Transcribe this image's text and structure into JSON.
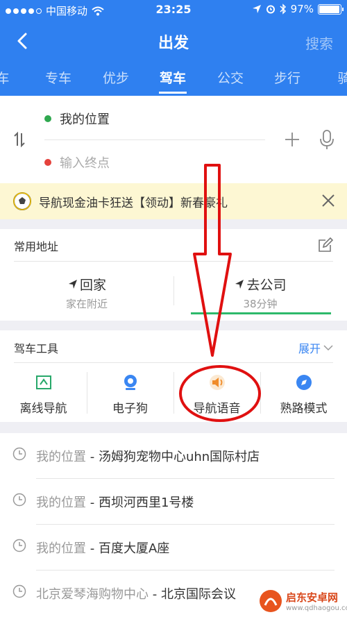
{
  "status_bar": {
    "carrier": "中国移动",
    "time": "23:25",
    "battery": "97%",
    "battery_level": 0.97
  },
  "header": {
    "title": "出发",
    "search_label": "搜索"
  },
  "tabs": [
    {
      "label": "车"
    },
    {
      "label": "专车"
    },
    {
      "label": "优步"
    },
    {
      "label": "驾车",
      "active": true
    },
    {
      "label": "公交"
    },
    {
      "label": "步行"
    },
    {
      "label": "骑"
    }
  ],
  "route": {
    "start": "我的位置",
    "end_placeholder": "输入终点",
    "start_color": "#2fa84f",
    "end_color": "#e5423c"
  },
  "banner": {
    "text": "导航现金油卡狂送【领动】新春豪礼"
  },
  "favorites": {
    "title": "常用地址",
    "items": [
      {
        "name": "回家",
        "sub": "家在附近"
      },
      {
        "name": "去公司",
        "sub": "38分钟"
      }
    ]
  },
  "tools": {
    "title": "驾车工具",
    "expand_label": "展开",
    "items": [
      {
        "label": "离线导航",
        "icon": "offline-map-icon"
      },
      {
        "label": "电子狗",
        "icon": "camera-icon"
      },
      {
        "label": "导航语音",
        "icon": "speaker-icon"
      },
      {
        "label": "熟路模式",
        "icon": "compass-icon"
      }
    ]
  },
  "history": [
    {
      "from": "我的位置",
      "to": "汤姆狗宠物中心uhn国际村店"
    },
    {
      "from": "我的位置",
      "to": "西坝河西里1号楼"
    },
    {
      "from": "我的位置",
      "to": "百度大厦A座"
    },
    {
      "from": "北京爱琴海购物中心",
      "to": "北京国际会议"
    }
  ],
  "separator": " - ",
  "watermark": {
    "name": "启东安卓网",
    "url": "www.qdhaogou.com"
  },
  "colors": {
    "brand_blue": "#2f80f0",
    "annotation_red": "#e01010",
    "active_underline": "#2db96a"
  }
}
